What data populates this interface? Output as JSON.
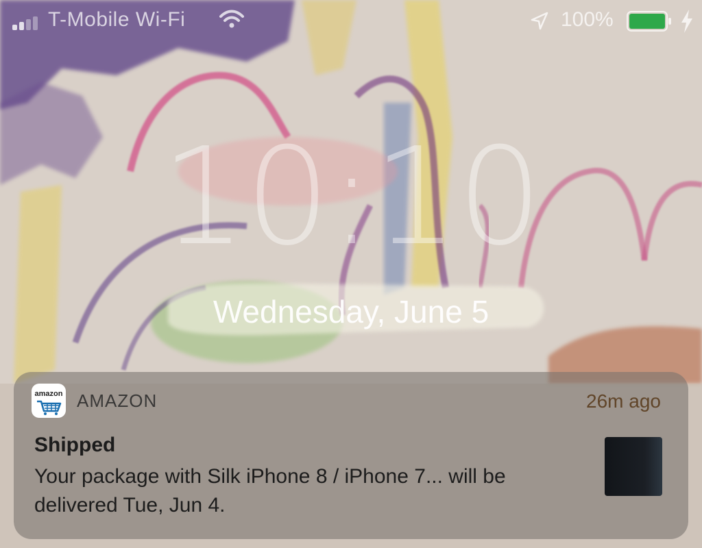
{
  "status_bar": {
    "carrier": "T-Mobile Wi-Fi",
    "battery_percent": "100%",
    "battery_level": 1.0,
    "signal_icon": "signal-bars-icon",
    "wifi_icon": "wifi-icon",
    "location_icon": "location-arrow-icon",
    "charging_icon": "bolt-icon",
    "battery_color": "#2ea84a"
  },
  "lock_screen": {
    "time": "10:10",
    "date": "Wednesday, June 5"
  },
  "notification": {
    "app_icon_text": "amazon",
    "app_icon": "amazon-cart-icon",
    "app_name": "AMAZON",
    "time_ago": "26m ago",
    "title": "Shipped",
    "body": "Your package with Silk iPhone 8 / iPhone 7... will be delivered Tue, Jun 4.",
    "thumbnail": "product-thumbnail",
    "accent_color": "#1a6fb0"
  }
}
